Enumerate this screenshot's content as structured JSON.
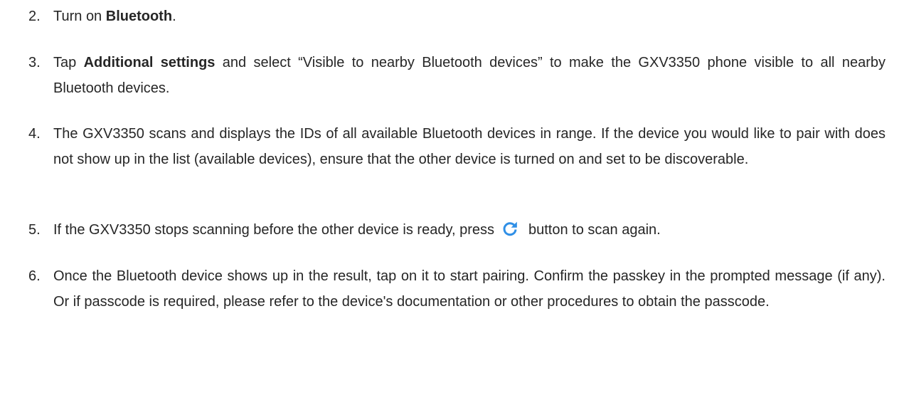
{
  "steps": [
    {
      "number": "2.",
      "before": "Turn on ",
      "bold": "Bluetooth",
      "after": "."
    },
    {
      "number": "3.",
      "before": "Tap ",
      "bold": "Additional settings",
      "after": " and select “Visible to nearby Bluetooth devices” to make the GXV3350 phone visible to all nearby Bluetooth devices."
    },
    {
      "number": "4.",
      "text": "The GXV3350 scans and displays the IDs of all available Bluetooth devices in range. If the device you would like to pair with does not show up in the list (available devices), ensure that the other device is turned on and set to be discoverable."
    },
    {
      "number": "5.",
      "before": "If the GXV3350 stops scanning before the other device is ready, press",
      "icon": "refresh-icon",
      "after": "button to scan again."
    },
    {
      "number": "6.",
      "text": "Once the Bluetooth device shows up in the result, tap on it to start pairing. Confirm the passkey in the prompted message (if any). Or if passcode is required, please refer to the device's documentation or other procedures to obtain the passcode."
    }
  ],
  "colors": {
    "text": "#262626",
    "icon": "#2f8fe6"
  }
}
